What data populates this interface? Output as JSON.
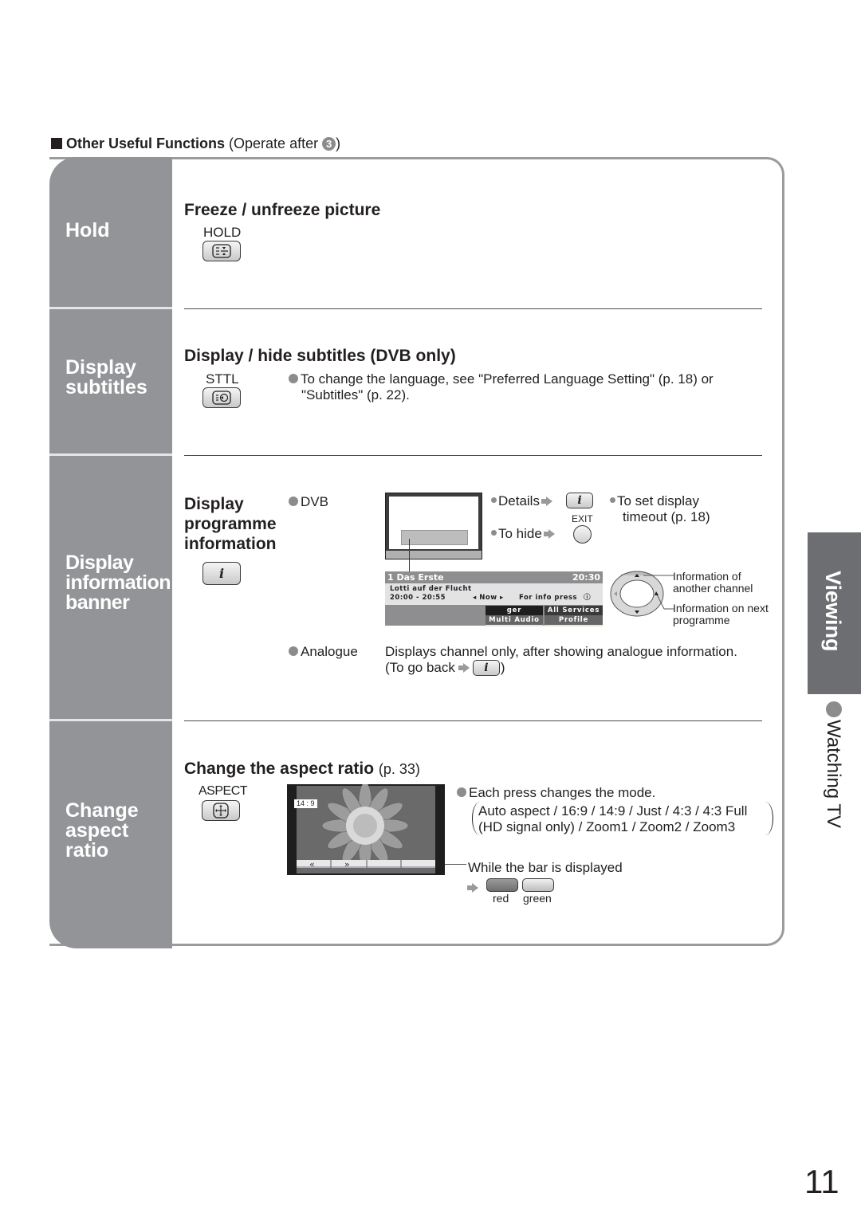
{
  "section_header": {
    "title": "Other Useful Functions",
    "note_prefix": "(Operate after ",
    "step_number": "3",
    "note_suffix": ")"
  },
  "rows": [
    {
      "label": [
        "Hold"
      ],
      "heading": "Freeze / unfreeze picture",
      "button_label": "HOLD",
      "button_icon": "hold-icon"
    },
    {
      "label": [
        "Display",
        "subtitles"
      ],
      "heading": "Display / hide subtitles (DVB only)",
      "button_label": "STTL",
      "button_icon": "subtitle-icon",
      "note_line1": "To change the language, see \"Preferred Language Setting\" (p. 18) or",
      "note_line2": "\"Subtitles\" (p. 22)."
    },
    {
      "label": [
        "Display",
        "information",
        "banner"
      ],
      "heading": [
        "Display",
        "programme",
        "information"
      ],
      "button_icon": "info-icon",
      "info_glyph": "i",
      "dvb_label": "DVB",
      "details_label": "Details",
      "exit_label": "EXIT",
      "hide_label": "To hide",
      "timeout_line1": "To set display",
      "timeout_line2": "timeout (p. 18)",
      "banner": {
        "channel": "1 Das Erste",
        "time": "20:30",
        "programme": "Lotti auf der Flucht",
        "time_range": "20:00 - 20:55",
        "now": "Now",
        "info_press": "For info press",
        "cell_lang": "ger",
        "cell_services": "All Services",
        "cell_audio": "Multi Audio",
        "cell_profile": "Profile"
      },
      "callout_channel_1": "Information of",
      "callout_channel_2": "another channel",
      "callout_next_1": "Information on next",
      "callout_next_2": "programme",
      "analogue_label": "Analogue",
      "analogue_line1": "Displays channel only, after showing analogue information.",
      "analogue_line2_prefix": "(To go back",
      "analogue_line2_suffix": ")"
    },
    {
      "label": [
        "Change",
        "aspect",
        "ratio"
      ],
      "heading": "Change the aspect ratio",
      "heading_ref": "(p. 33)",
      "button_label": "ASPECT",
      "button_icon": "aspect-icon",
      "screen_badge": "14 : 9",
      "each_press": "Each press changes the mode.",
      "modes_line1": "Auto aspect / 16:9 / 14:9 / Just / 4:3 / 4:3 Full",
      "modes_line2": "(HD signal only) / Zoom1 / Zoom2 / Zoom3",
      "bar_note": "While the bar is displayed",
      "red_label": "red",
      "green_label": "green"
    }
  ],
  "side_tab": {
    "category": "Viewing",
    "topic": "Watching TV"
  },
  "page_number": "11",
  "colors": {
    "tab_gray": "#939497",
    "dark_tab": "#6d6e71",
    "bullet_gray": "#8c8c8c",
    "text": "#231f20"
  }
}
